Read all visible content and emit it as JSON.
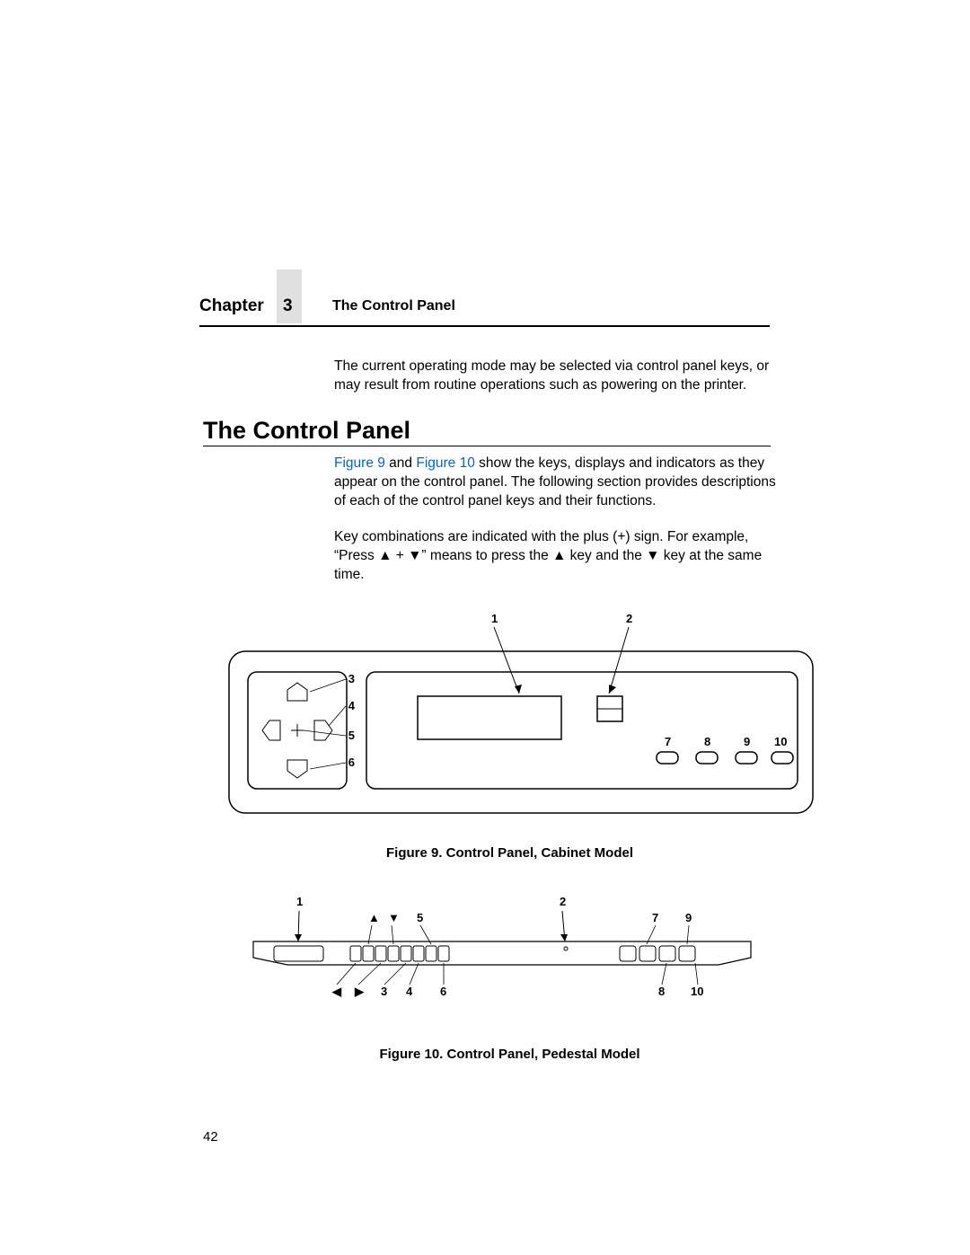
{
  "header": {
    "chapter_label": "Chapter",
    "chapter_number": "3",
    "title": "The Control Panel"
  },
  "intro": "The current operating mode may be selected via control panel keys, or may result from routine operations such as powering on the printer.",
  "section": {
    "heading": "The Control Panel",
    "p1_pre": "",
    "fig9_link": "Figure 9",
    "p1_mid": " and ",
    "fig10_link": "Figure 10",
    "p1_post": " show the keys, displays and indicators as they appear on the control panel. The following section provides descriptions of each of the control panel keys and their functions.",
    "p2": "Key combinations are indicated with the plus (+) sign. For example, “Press ▲ + ▼” means to press the ▲ key and the ▼ key at the same time."
  },
  "figure9": {
    "caption": "Figure 9. Control Panel, Cabinet Model",
    "labels": {
      "top1": "1",
      "top2": "2",
      "left3": "3",
      "left4": "4",
      "left5": "5",
      "left6": "6",
      "r7": "7",
      "r8": "8",
      "r9": "9",
      "r10": "10"
    }
  },
  "figure10": {
    "caption": "Figure 10. Control Panel, Pedestal Model",
    "labels": {
      "top1": "1",
      "top2": "2",
      "mid5": "5",
      "r7": "7",
      "r9": "9",
      "b3": "3",
      "b4": "4",
      "b6": "6",
      "br8": "8",
      "br10": "10",
      "up": "▲",
      "down": "▼",
      "left": "◀",
      "right": "▶"
    }
  },
  "page_number": "42"
}
